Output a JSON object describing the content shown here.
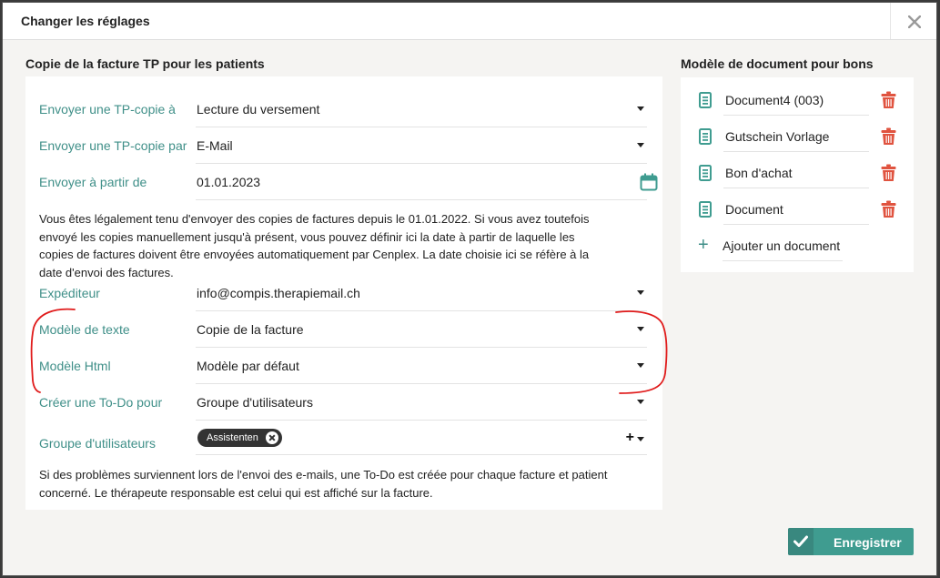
{
  "dialog": {
    "title": "Changer les réglages",
    "close_icon": "close-icon"
  },
  "left_section": {
    "title": "Copie de la facture TP pour les patients",
    "fields": [
      {
        "label": "Envoyer une TP-copie à",
        "value": "Lecture du versement",
        "control": "select"
      },
      {
        "label": "Envoyer une TP-copie par",
        "value": "E-Mail",
        "control": "select"
      },
      {
        "label": "Envoyer à partir de",
        "value": "01.01.2023",
        "control": "date",
        "icon": "calendar-icon"
      },
      {
        "label": "Expéditeur",
        "value": "info@compis.therapiemail.ch",
        "control": "select"
      },
      {
        "label": "Modèle de texte",
        "value": "Copie de la facture",
        "control": "select"
      },
      {
        "label": "Modèle Html",
        "value": "Modèle par défaut",
        "control": "select"
      },
      {
        "label": "Créer une To-Do pour",
        "value": "Groupe d'utilisateurs",
        "control": "select"
      },
      {
        "label": "Groupe d'utilisateurs",
        "chip": "Assistenten",
        "control": "multiselect",
        "add_icon": "plus-icon"
      }
    ],
    "info_text": "Vous êtes légalement tenu d'envoyer des copies de factures depuis le 01.01.2022. Si vous avez toutefois envoyé les copies manuellement jusqu'à présent, vous pouvez définir ici la date à partir de laquelle les copies de factures doivent être envoyées automatiquement par Cenplex. La date choisie ici se réfère à la date d'envoi des factures.",
    "info_text_lines": [
      "Vous êtes légalement tenu d'envoyer des copies de factures depuis le 01.01.2022. Si vous avez toutefois",
      "envoyé les copies manuellement jusqu'à présent, vous pouvez définir ici la date à partir de laquelle les",
      "copies de factures doivent être envoyées automatiquement par Cenplex. La date choisie ici se réfère à la",
      "date d'envoi des factures."
    ],
    "footer_text": "Si des problèmes surviennent lors de l'envoi des e-mails, une To-Do est créée pour chaque facture et patient concerné. Le thérapeute responsable est celui qui est affiché sur la facture.",
    "footer_text_lines": [
      "Si des problèmes surviennent lors de l'envoi des e-mails, une To-Do est créée pour chaque facture et patient",
      "concerné. Le thérapeute responsable est celui qui est affiché sur la facture."
    ]
  },
  "right_section": {
    "title": "Modèle de document pour bons",
    "documents": [
      {
        "name": "Document4 (003)",
        "icon": "document-icon",
        "delete_icon": "trash-icon"
      },
      {
        "name": "Gutschein Vorlage",
        "icon": "document-icon",
        "delete_icon": "trash-icon"
      },
      {
        "name": "Bon d'achat",
        "icon": "document-icon",
        "delete_icon": "trash-icon"
      },
      {
        "name": "Document",
        "icon": "document-icon",
        "delete_icon": "trash-icon"
      }
    ],
    "add_label": "Ajouter un document",
    "add_icon": "plus-icon"
  },
  "footer": {
    "save_label": "Enregistrer",
    "save_icon": "check-icon"
  },
  "colors": {
    "accent": "#3f8f88",
    "delete": "#e0533f",
    "annotation": "#e01b1b",
    "button": "#3f9c90"
  }
}
